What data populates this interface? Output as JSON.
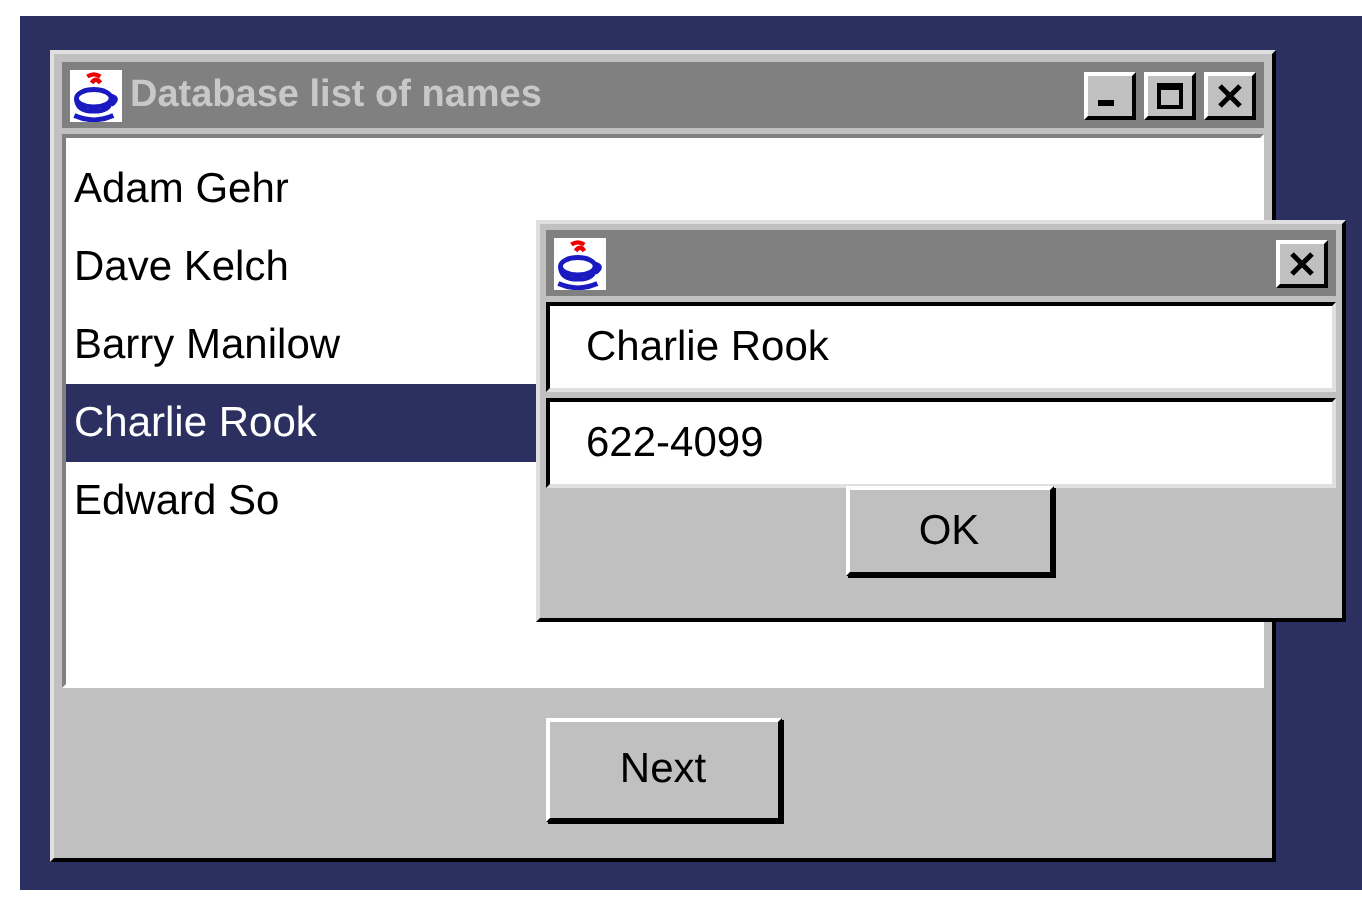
{
  "main_window": {
    "title": "Database list of names",
    "names": [
      {
        "label": "Adam Gehr",
        "selected": false
      },
      {
        "label": "Dave Kelch",
        "selected": false
      },
      {
        "label": "Barry Manilow",
        "selected": false
      },
      {
        "label": "Charlie Rook",
        "selected": true
      },
      {
        "label": "Edward So",
        "selected": false
      }
    ],
    "button": "Next"
  },
  "dialog": {
    "fields": [
      "Charlie Rook",
      "622-4099"
    ],
    "button": "OK"
  }
}
